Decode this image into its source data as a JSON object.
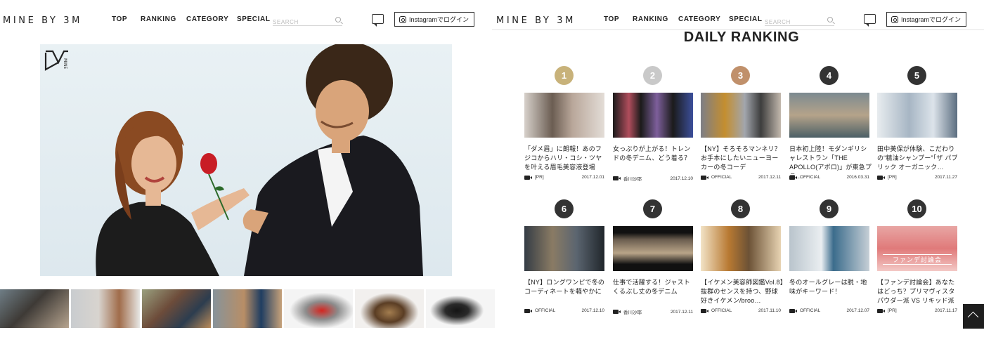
{
  "header": {
    "logo": "MINE BY 3M",
    "nav": [
      "TOP",
      "RANKING",
      "CATEGORY",
      "SPECIAL"
    ],
    "search_placeholder": "SEARCH",
    "instagram_login": "Instagramでログイン"
  },
  "ranking": {
    "title": "DAILY RANKING",
    "items": [
      {
        "rank": "1",
        "title": "「ダメ眉」に朗報！あのフジコからハリ・コシ・ツヤを叶える眉毛美容液登場",
        "author": "[PR]",
        "date": "2017.12.01",
        "badge_color": "#c8b27a"
      },
      {
        "rank": "2",
        "title": "女っぷりが上がる！トレンドの冬デニム、どう着る？",
        "author": "香川沙耶",
        "date": "2017.12.10",
        "badge_color": "#c9c9c9"
      },
      {
        "rank": "3",
        "title": "【NY】そろそろマンネリ？お手本にしたいニューヨーカーの冬コーデ",
        "author": "OFFICIAL",
        "date": "2017.12.11",
        "badge_color": "#c0906b"
      },
      {
        "rank": "4",
        "title": "日本初上陸！モダンギリシャレストラン「THE APOLLO(アポロ)」が東急プラ…",
        "author": "OFFICIAL",
        "date": "2016.03.31",
        "badge_color": "#333333"
      },
      {
        "rank": "5",
        "title": "田中美保が体験、こだわりの“精油シャンプー”「ザ パブリック オーガニック…",
        "author": "[PR]",
        "date": "2017.11.27",
        "badge_color": "#333333"
      },
      {
        "rank": "6",
        "title": "【NY】ロングワンピで冬のコーディネートを軽やかに",
        "author": "OFFICIAL",
        "date": "2017.12.10",
        "badge_color": "#333333"
      },
      {
        "rank": "7",
        "title": "仕事で活躍する！ジャストくるぶし丈の冬デニム",
        "author": "香川沙耶",
        "date": "2017.12.11",
        "badge_color": "#333333"
      },
      {
        "rank": "8",
        "title": "【イケメン美容師図鑑Vol.8】抜群のセンスを持つ、野球好きイケメン/broo…",
        "author": "OFFICIAL",
        "date": "2017.11.10",
        "badge_color": "#333333"
      },
      {
        "rank": "9",
        "title": "冬のオールグレーは脱・地味がキーワード！",
        "author": "OFFICIAL",
        "date": "2017.12.07",
        "badge_color": "#333333"
      },
      {
        "rank": "10",
        "title": "【ファンデ討論会】あなたはどっち？プリマヴィスタ パウダー派 VS リキッド派",
        "author": "[PR]",
        "date": "2017.11.17",
        "badge_color": "#333333"
      }
    ]
  },
  "thumb5_banner": "ファンデ討論会",
  "hero_logo_text": "MINE"
}
